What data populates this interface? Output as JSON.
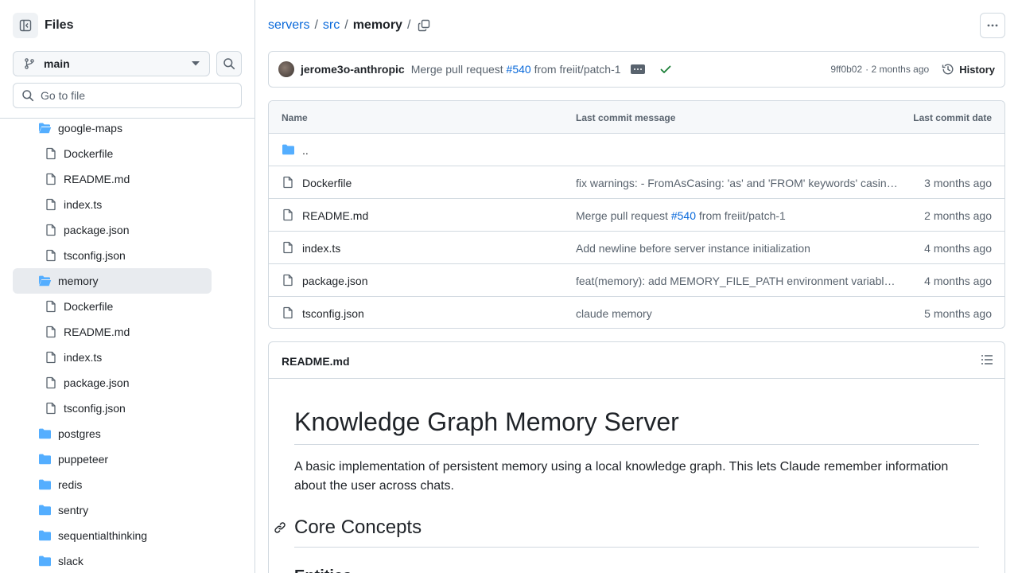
{
  "sidebar": {
    "title": "Files",
    "branch": "main",
    "goto_placeholder": "Go to file",
    "tree": [
      {
        "label": "google-maps",
        "type": "folder",
        "open": true,
        "depth": 1
      },
      {
        "label": "Dockerfile",
        "type": "file",
        "depth": 2
      },
      {
        "label": "README.md",
        "type": "file",
        "depth": 2
      },
      {
        "label": "index.ts",
        "type": "file",
        "depth": 2
      },
      {
        "label": "package.json",
        "type": "file",
        "depth": 2
      },
      {
        "label": "tsconfig.json",
        "type": "file",
        "depth": 2
      },
      {
        "label": "memory",
        "type": "folder",
        "open": true,
        "selected": true,
        "depth": 1
      },
      {
        "label": "Dockerfile",
        "type": "file",
        "depth": 2
      },
      {
        "label": "README.md",
        "type": "file",
        "depth": 2
      },
      {
        "label": "index.ts",
        "type": "file",
        "depth": 2
      },
      {
        "label": "package.json",
        "type": "file",
        "depth": 2
      },
      {
        "label": "tsconfig.json",
        "type": "file",
        "depth": 2
      },
      {
        "label": "postgres",
        "type": "folder",
        "depth": 1
      },
      {
        "label": "puppeteer",
        "type": "folder",
        "depth": 1
      },
      {
        "label": "redis",
        "type": "folder",
        "depth": 1
      },
      {
        "label": "sentry",
        "type": "folder",
        "depth": 1
      },
      {
        "label": "sequentialthinking",
        "type": "folder",
        "depth": 1
      },
      {
        "label": "slack",
        "type": "folder",
        "depth": 1
      }
    ]
  },
  "breadcrumb": {
    "repo": "servers",
    "dir": "src",
    "current": "memory",
    "sep": "/"
  },
  "commit": {
    "author": "jerome3o-anthropic",
    "message_prefix": "Merge pull request ",
    "pr": "#540",
    "message_suffix": " from freiit/patch-1",
    "sha": "9ff0b02",
    "age": "· 2 months ago",
    "history_label": "History"
  },
  "table": {
    "headers": {
      "name": "Name",
      "message": "Last commit message",
      "date": "Last commit date"
    },
    "parent": "..",
    "rows": [
      {
        "name": "Dockerfile",
        "message": "fix warnings: - FromAsCasing: 'as' and 'FROM' keywords' casing do not match",
        "date": "3 months ago"
      },
      {
        "name": "README.md",
        "message_prefix": "Merge pull request ",
        "pr": "#540",
        "message_suffix": " from freiit/patch-1",
        "date": "2 months ago"
      },
      {
        "name": "index.ts",
        "message": "Add newline before server instance initialization",
        "date": "4 months ago"
      },
      {
        "name": "package.json",
        "message": "feat(memory): add MEMORY_FILE_PATH environment variable support",
        "date": "4 months ago"
      },
      {
        "name": "tsconfig.json",
        "message": "claude memory",
        "date": "5 months ago"
      }
    ]
  },
  "readme": {
    "filename": "README.md",
    "h1": "Knowledge Graph Memory Server",
    "intro": "A basic implementation of persistent memory using a local knowledge graph. This lets Claude remember information about the user across chats.",
    "h2": "Core Concepts",
    "h3": "Entities"
  },
  "colors": {
    "link": "#0969da",
    "text": "#1f2328",
    "muted": "#59636e",
    "border": "#d1d9e0",
    "folder": "#54aeff",
    "success": "#1a7f37"
  }
}
